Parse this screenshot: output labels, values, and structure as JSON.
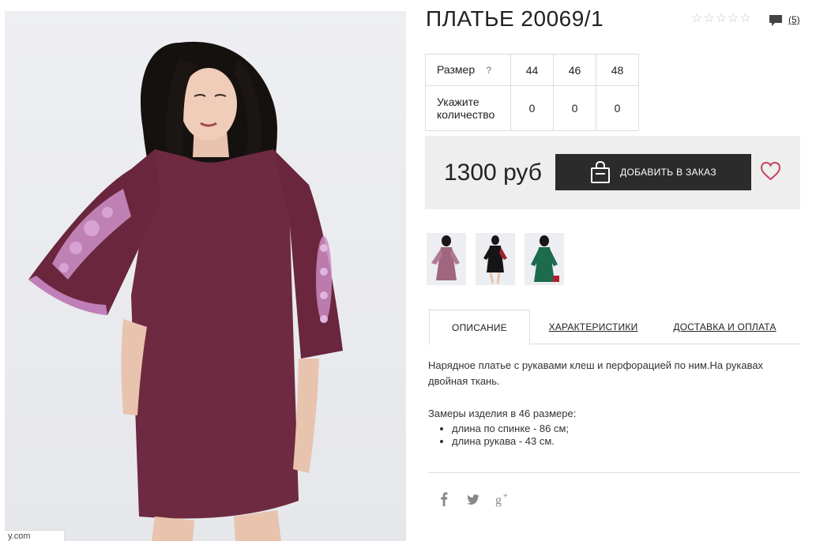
{
  "product": {
    "title": "ПЛАТЬЕ 20069/1",
    "review_count": "(5)",
    "price": "1300 руб",
    "add_to_order_label": "ДОБАВИТЬ В ЗАКАЗ",
    "watermark": "y.com"
  },
  "size_table": {
    "size_label": "Размер",
    "help_mark": "?",
    "qty_label": "Укажите количество",
    "sizes": [
      "44",
      "46",
      "48"
    ],
    "quantities": [
      "0",
      "0",
      "0"
    ]
  },
  "rating": {
    "stars_filled": 0,
    "stars_total": 5
  },
  "thumbnails": [
    "dress-purple",
    "dress-black",
    "dress-green"
  ],
  "tabs": [
    "ОПИСАНИЕ",
    "ХАРАКТЕРИСТИКИ",
    "ДОСТАВКА И ОПЛАТА"
  ],
  "description": {
    "text": "Нарядное платье с рукавами клеш и перфорацией по ним.На рукавах двойная ткань.",
    "measures_title": "Замеры изделия в 46 размере:",
    "measures": [
      "длина по спинке - 86 см;",
      "длина рукава - 43 см."
    ]
  },
  "social": [
    "facebook-icon",
    "twitter-icon",
    "google-plus-icon"
  ],
  "colors": {
    "dress": "#6e2a40",
    "accent_heart": "#c8405e",
    "button_bg": "#2b2b2b"
  }
}
